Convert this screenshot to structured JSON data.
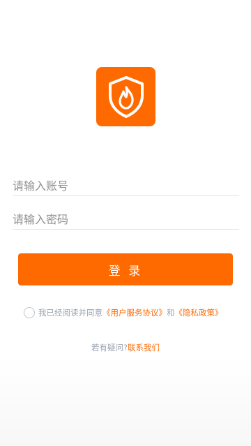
{
  "logo": {
    "icon": "shield-fire-icon",
    "color": "#ff6a00"
  },
  "form": {
    "account_placeholder": "请输入账号",
    "password_placeholder": "请输入密码",
    "login_label": "登 录"
  },
  "agreement": {
    "prefix": "我已经阅读并同意",
    "user_agreement": "《用户服务协议》",
    "conjunction": "和",
    "privacy_policy": "《隐私政策》"
  },
  "help": {
    "question": "若有疑问?",
    "contact_link": "联系我们"
  },
  "colors": {
    "accent": "#ff6a00",
    "muted_text": "#9aa3b0",
    "placeholder": "#8f8f8f"
  }
}
